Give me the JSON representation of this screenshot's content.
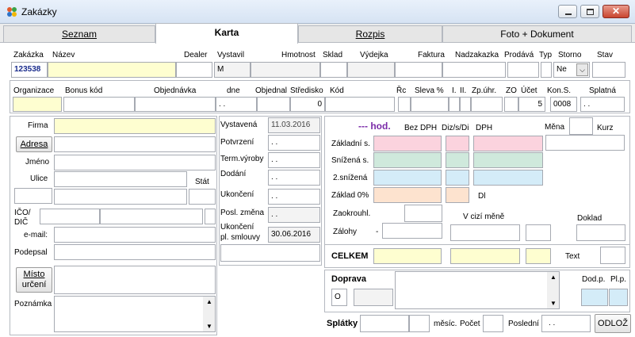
{
  "window": {
    "title": "Zakázky"
  },
  "tabs": [
    {
      "label": "Seznam"
    },
    {
      "label": "Karta"
    },
    {
      "label": "Rozpis"
    },
    {
      "label": "Foto + Dokument"
    }
  ],
  "row1": {
    "zakazka_label": "Zakázka",
    "nazev_label": "Název",
    "dealer_label": "Dealer",
    "vystavil_label": "Vystavil",
    "hmotnost_label": "Hmotnost",
    "sklad_label": "Sklad",
    "vydejka_label": "Výdejka",
    "faktura_label": "Faktura",
    "nadzakazka_label": "Nadzakazka",
    "prodava_label": "Prodává",
    "typ_label": "Typ",
    "storno_label": "Storno",
    "stav_label": "Stav",
    "zakazka_value": "123538",
    "vystavil_value": "M",
    "storno_value": "Ne"
  },
  "row2": {
    "organizace_label": "Organizace",
    "bonus_label": "Bonus kód",
    "objednavka_label": "Objednávka",
    "dne_label": "dne",
    "objednal_label": "Objednal",
    "stredisko_label": "Středisko",
    "kod_label": "Kód",
    "rc_label": "Řc",
    "sleva_label": "Sleva %",
    "i_label": "I.",
    "ii_label": "II.",
    "zpuhr_label": "Zp.úhr.",
    "zo_label": "ZO",
    "ucet_label": "Účet",
    "kons_label": "Kon.S.",
    "splatna_label": "Splatná",
    "dne_value": ". .",
    "stredisko_value": "0",
    "ucet_value": "5",
    "kons_value": "0008",
    "splatna_value": ". ."
  },
  "left": {
    "firma_label": "Firma",
    "adresa_button": "Adresa",
    "jmeno_label": "Jméno",
    "ulice_label": "Ulice",
    "stat_label": "Stát",
    "ico_label": "IČO/",
    "dic_label": "DIČ",
    "email_label": "e-mail:",
    "podepsal_label": "Podepsal",
    "misto_button_1": "Místo",
    "misto_button_2": "určení",
    "poznamka_label": "Poznámka"
  },
  "dates": {
    "vystavena_label": "Vystavená",
    "vystavena_value": "11.03.2016",
    "potvrzeni_label": "Potvrzení",
    "potvrzeni_value": ". .",
    "term_label": "Term.výroby",
    "term_value": ". .",
    "dodani_label": "Dodání",
    "dodani_value": ". .",
    "ukonceni_label": "Ukončení",
    "ukonceni_value": ". .",
    "posl_label": "Posl. změna",
    "posl_value": ". .",
    "ukpl_label_1": "Ukončení",
    "ukpl_label_2": "pl. smlouvy",
    "ukpl_value": "30.06.2016"
  },
  "prices": {
    "hod": "--- hod.",
    "bez_dph": "Bez DPH",
    "diz": "Diz/s/Di",
    "dph": "DPH",
    "mena": "Měna",
    "kurz": "Kurz",
    "zakladni": "Základní s.",
    "snizena": "Snížená s.",
    "snizena2": "2.snížená",
    "zaklad0": "Základ 0%",
    "dl": "Dl",
    "zaokrouhl": "Zaokrouhl.",
    "v_cizi_mene": "V cizí měně",
    "doklad": "Doklad",
    "zalohy": "Zálohy",
    "zalohy_dash": "-",
    "celkem": "CELKEM",
    "text": "Text"
  },
  "doprava": {
    "label": "Doprava",
    "o_value": "O",
    "dodp": "Dod.p.",
    "plp": "Pl.p."
  },
  "splatky": {
    "label": "Splátky",
    "mesic": "měsíc.",
    "pocet": "Počet",
    "posledni": "Poslední",
    "posledni_value": ". .",
    "odloz": "ODLOŽ"
  }
}
